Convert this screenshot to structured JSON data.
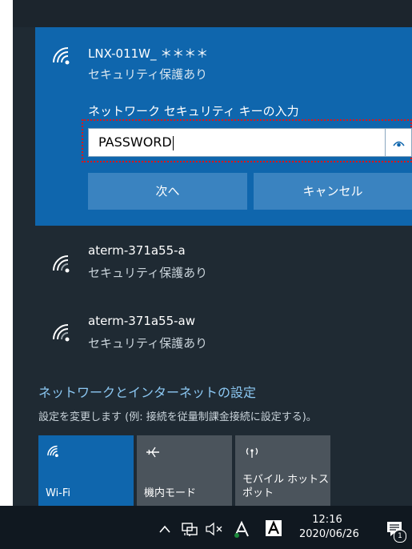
{
  "selected_network": {
    "ssid": "LNX-011W_ ＊＊＊＊",
    "status": "セキュリティ保護あり",
    "prompt": "ネットワーク セキュリティ キーの入力",
    "password_value": "PASSWORD",
    "next_label": "次へ",
    "cancel_label": "キャンセル"
  },
  "networks": [
    {
      "ssid": "aterm-371a55-a",
      "status": "セキュリティ保護あり"
    },
    {
      "ssid": "aterm-371a55-aw",
      "status": "セキュリティ保護あり"
    }
  ],
  "settings": {
    "link": "ネットワークとインターネットの設定",
    "description": "設定を変更します (例: 接続を従量制課金接続に設定する)。"
  },
  "quick_actions": [
    {
      "label": "Wi-Fi",
      "icon": "wifi-icon",
      "active": true
    },
    {
      "label": "機内モード",
      "icon": "airplane-icon",
      "active": false
    },
    {
      "label": "モバイル ホットスポット",
      "label_lines": [
        "モバイル ホットス",
        "ポット"
      ],
      "icon": "hotspot-icon",
      "active": false
    }
  ],
  "taskbar": {
    "time": "12:16",
    "date": "2020/06/26",
    "notification_count": "1",
    "icons": [
      "chevron-up-icon",
      "network-icon",
      "speaker-muted-icon",
      "adobe-icon",
      "app-icon",
      "action-center-icon"
    ]
  },
  "colors": {
    "flyout_bg": "#1f2a33",
    "selected_bg": "#0f66ad",
    "button_bg": "#3a83c0",
    "link": "#8cc8f3",
    "tile_off": "#4b545c",
    "taskbar": "#101820",
    "focus_outline": "#e01515"
  }
}
